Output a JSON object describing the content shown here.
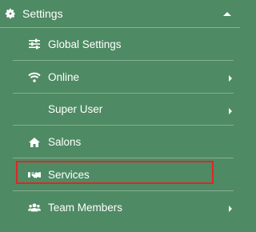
{
  "header": {
    "title": "Settings",
    "icon": "gear-icon"
  },
  "menu": {
    "items": [
      {
        "label": "Global Settings",
        "icon": "sliders-icon",
        "has_submenu": false
      },
      {
        "label": "Online",
        "icon": "wifi-icon",
        "has_submenu": true
      },
      {
        "label": "Super User",
        "icon": "",
        "has_submenu": true
      },
      {
        "label": "Salons",
        "icon": "home-icon",
        "has_submenu": false
      },
      {
        "label": "Services",
        "icon": "handshake-icon",
        "has_submenu": false,
        "highlighted": true
      },
      {
        "label": "Team Members",
        "icon": "users-icon",
        "has_submenu": true
      }
    ]
  },
  "colors": {
    "background": "#4e8a63",
    "text": "#ffffff",
    "highlight_border": "#e02626"
  }
}
